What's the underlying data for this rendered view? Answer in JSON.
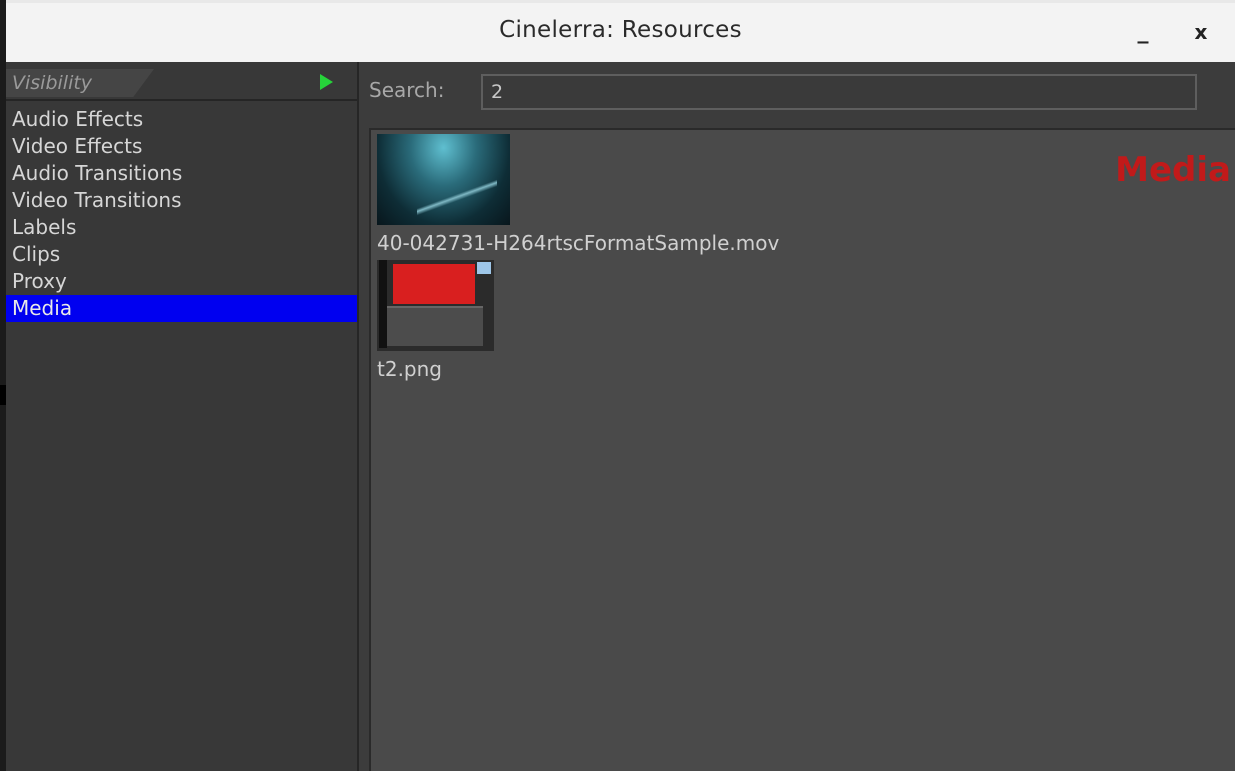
{
  "window": {
    "title": "Cinelerra: Resources"
  },
  "controls": {
    "minimize_icon": "minimize-icon",
    "close_icon": "close-icon",
    "minimize_glyph": "_",
    "close_glyph": "x"
  },
  "sidebar": {
    "visibility_label": "Visibility",
    "items": [
      {
        "label": "Audio Effects",
        "selected": false
      },
      {
        "label": "Video Effects",
        "selected": false
      },
      {
        "label": "Audio Transitions",
        "selected": false
      },
      {
        "label": "Video Transitions",
        "selected": false
      },
      {
        "label": "Labels",
        "selected": false
      },
      {
        "label": "Clips",
        "selected": false
      },
      {
        "label": "Proxy",
        "selected": false
      },
      {
        "label": "Media",
        "selected": true
      }
    ]
  },
  "search": {
    "label": "Search:",
    "value": "2"
  },
  "media": {
    "folder_title": "Media",
    "assets": [
      {
        "name": "40-042731-H264rtscFormatSample.mov",
        "thumb": "video-thumbnail"
      },
      {
        "name": "t2.png",
        "thumb": "image-thumbnail"
      }
    ]
  },
  "colors": {
    "selected": "#0000f0",
    "folder_title": "#c11a1a",
    "play": "#26d33a"
  }
}
